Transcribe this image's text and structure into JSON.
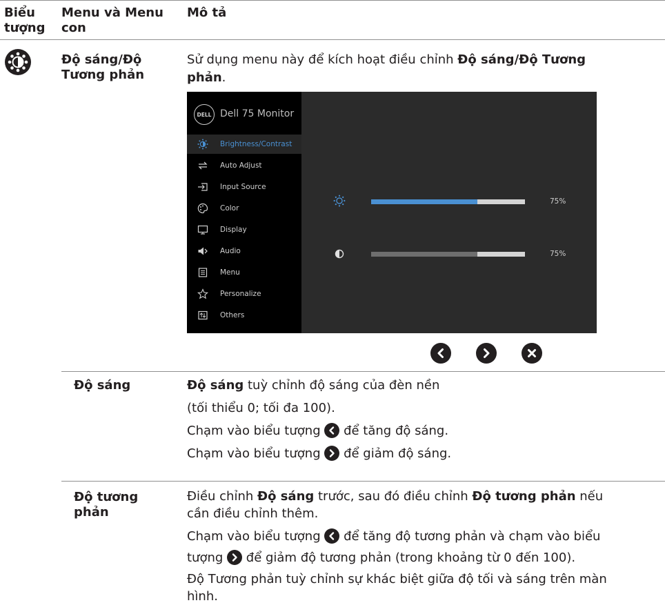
{
  "header": {
    "col1": "Biểu tượng",
    "col1_line1": "Biểu",
    "col1_line2": "tượng",
    "col2_line1": "Menu và Menu",
    "col2_line2": "con",
    "col3": "Mô tả"
  },
  "main_row": {
    "menu_line1": "Độ sáng/Độ",
    "menu_line2": "Tương phản",
    "desc_prefix": "Sử dụng menu này để kích hoạt điều chỉnh ",
    "desc_bold_1": "Độ sáng/Độ Tương",
    "desc_bold_2": "phản",
    "desc_suffix": "."
  },
  "osd": {
    "logo": "DELL",
    "title": "Dell 75 Monitor",
    "menu_items": [
      {
        "label": "Brightness/Contrast",
        "icon": "brightness-icon",
        "selected": true
      },
      {
        "label": "Auto Adjust",
        "icon": "auto-adjust-icon"
      },
      {
        "label": "Input Source",
        "icon": "input-source-icon"
      },
      {
        "label": "Color",
        "icon": "color-icon"
      },
      {
        "label": "Display",
        "icon": "display-icon"
      },
      {
        "label": "Audio",
        "icon": "audio-icon"
      },
      {
        "label": "Menu",
        "icon": "menu-icon"
      },
      {
        "label": "Personalize",
        "icon": "star-icon"
      },
      {
        "label": "Others",
        "icon": "others-icon"
      }
    ],
    "brightness": {
      "value_label": "75%",
      "fraction": 0.69,
      "fill_color": "#4a90d2"
    },
    "contrast": {
      "value_label": "75%",
      "fraction": 0.69,
      "fill_color": "#6e6e6e"
    }
  },
  "brightness_row": {
    "label": "Độ sáng",
    "line1_bold": "Độ sáng",
    "line1_rest": " tuỳ chỉnh độ sáng của đèn nền",
    "line2": "(tối thiểu 0; tối đa 100).",
    "line3_pre": "Chạm vào biểu tượng ",
    "line3_post": " để tăng độ sáng.",
    "line4_pre": "Chạm vào biểu tượng ",
    "line4_post": " để giảm độ sáng."
  },
  "contrast_row": {
    "label_line1": "Độ tương",
    "label_line2": "phản",
    "p1_pre": "Điều chỉnh ",
    "p1_bold1": "Độ sáng",
    "p1_mid": " trước, sau đó điều chỉnh ",
    "p1_bold2": "Độ tương phản",
    "p1_post": " nếu",
    "p1_line2": "cần điều chỉnh thêm.",
    "p2_line1_pre": "Chạm vào biểu tượng ",
    "p2_line1_post": " để tăng độ tương phản và chạm vào biểu",
    "p2_line2_pre": "tượng ",
    "p2_line2_post": " để giảm độ tương phản (trong khoảng từ 0 đến 100).",
    "p3_line1": "Độ Tương phản tuỳ chỉnh sự khác biệt giữa độ tối và sáng trên màn",
    "p3_line2": "hình."
  }
}
